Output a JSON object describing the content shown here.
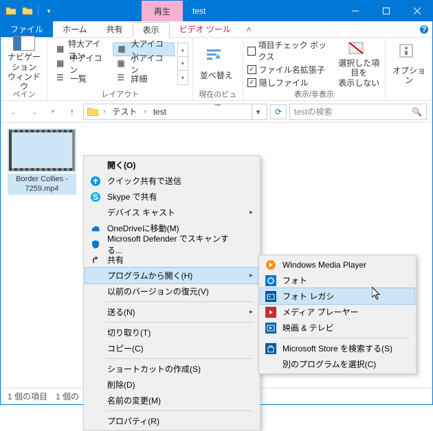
{
  "titlebar": {
    "context_tab": "再生",
    "title": "test"
  },
  "tabs": {
    "file": "ファイル",
    "home": "ホーム",
    "share": "共有",
    "view": "表示",
    "video_tools": "ビデオ ツール"
  },
  "ribbon": {
    "pane_group": "ペイン",
    "nav_pane": "ナビゲーション\nウィンドウ",
    "layout_group": "レイアウト",
    "layout": {
      "extra_large": "特大アイコン",
      "large": "大アイコン",
      "medium": "中アイコン",
      "small": "小アイコン",
      "list": "一覧",
      "details": "詳細"
    },
    "current_view_group": "現在のビュー",
    "sort": "並べ替え",
    "show_hide_group": "表示/非表示",
    "checks": {
      "item_check": "項目チェック ボックス",
      "file_ext": "ファイル名拡張子",
      "hidden": "隠しファイル"
    },
    "hide_selected": "選択した項目を\n表示しない",
    "options": "オプション"
  },
  "addr": {
    "crumb1": "テスト",
    "crumb2": "test",
    "search_placeholder": "testの検索"
  },
  "file": {
    "name": "Border Collies - 7259.mp4"
  },
  "status": {
    "count": "1 個の項目",
    "selected": "1 個の"
  },
  "ctx": {
    "open": "開く(O)",
    "quick_share": "クイック共有で送信",
    "skype": "Skype で共有",
    "cast": "デバイス キャスト",
    "onedrive": "OneDriveに移動(M)",
    "defender": "Microsoft Defender でスキャンする...",
    "share": "共有",
    "open_with": "プログラムから開く(H)",
    "prev_version": "以前のバージョンの復元(V)",
    "send_to": "送る(N)",
    "cut": "切り取り(T)",
    "copy": "コピー(C)",
    "shortcut": "ショートカットの作成(S)",
    "delete": "削除(D)",
    "rename": "名前の変更(M)",
    "properties": "プロパティ(R)"
  },
  "sub": {
    "wmp": "Windows Media Player",
    "photos": "フォト",
    "photos_legacy": "フォト レガシ",
    "media_player": "メディア プレーヤー",
    "movies_tv": "映画 & テレビ",
    "store": "Microsoft Store を検索する(S)",
    "choose": "別のプログラムを選択(C)"
  }
}
